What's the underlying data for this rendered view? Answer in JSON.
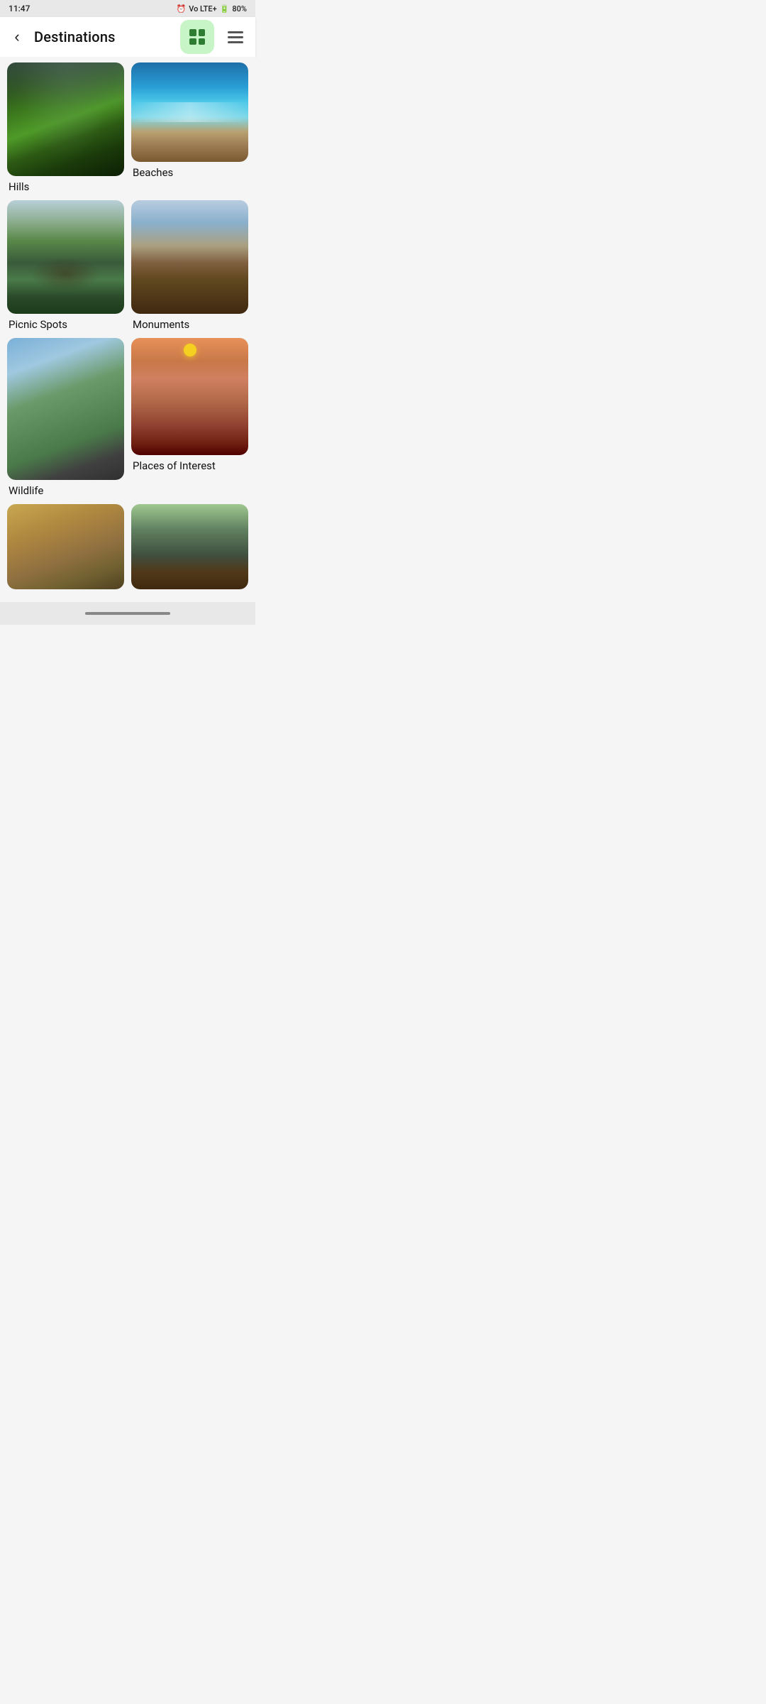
{
  "statusBar": {
    "time": "11:47",
    "battery": "80%",
    "signal": "LTE+"
  },
  "appBar": {
    "title": "Destinations",
    "backLabel": "back",
    "gridViewLabel": "grid view",
    "listViewLabel": "list view"
  },
  "destinations": [
    {
      "id": "hills",
      "label": "Hills",
      "imageType": "hills",
      "row": 0,
      "col": 0
    },
    {
      "id": "beaches",
      "label": "Beaches",
      "imageType": "beaches",
      "row": 0,
      "col": 1
    },
    {
      "id": "picnic-spots",
      "label": "Picnic Spots",
      "imageType": "picnic",
      "row": 1,
      "col": 0
    },
    {
      "id": "monuments",
      "label": "Monuments",
      "imageType": "monuments",
      "row": 1,
      "col": 1
    },
    {
      "id": "wildlife",
      "label": "Wildlife",
      "imageType": "wildlife",
      "row": 2,
      "col": 0
    },
    {
      "id": "places-of-interest",
      "label": "Places of Interest",
      "imageType": "places",
      "row": 2,
      "col": 1
    },
    {
      "id": "partial-bottom-left",
      "label": "",
      "imageType": "partial-bottom-left",
      "row": 3,
      "col": 0
    },
    {
      "id": "partial-bottom-right",
      "label": "",
      "imageType": "partial-bottom-right",
      "row": 3,
      "col": 1
    }
  ]
}
